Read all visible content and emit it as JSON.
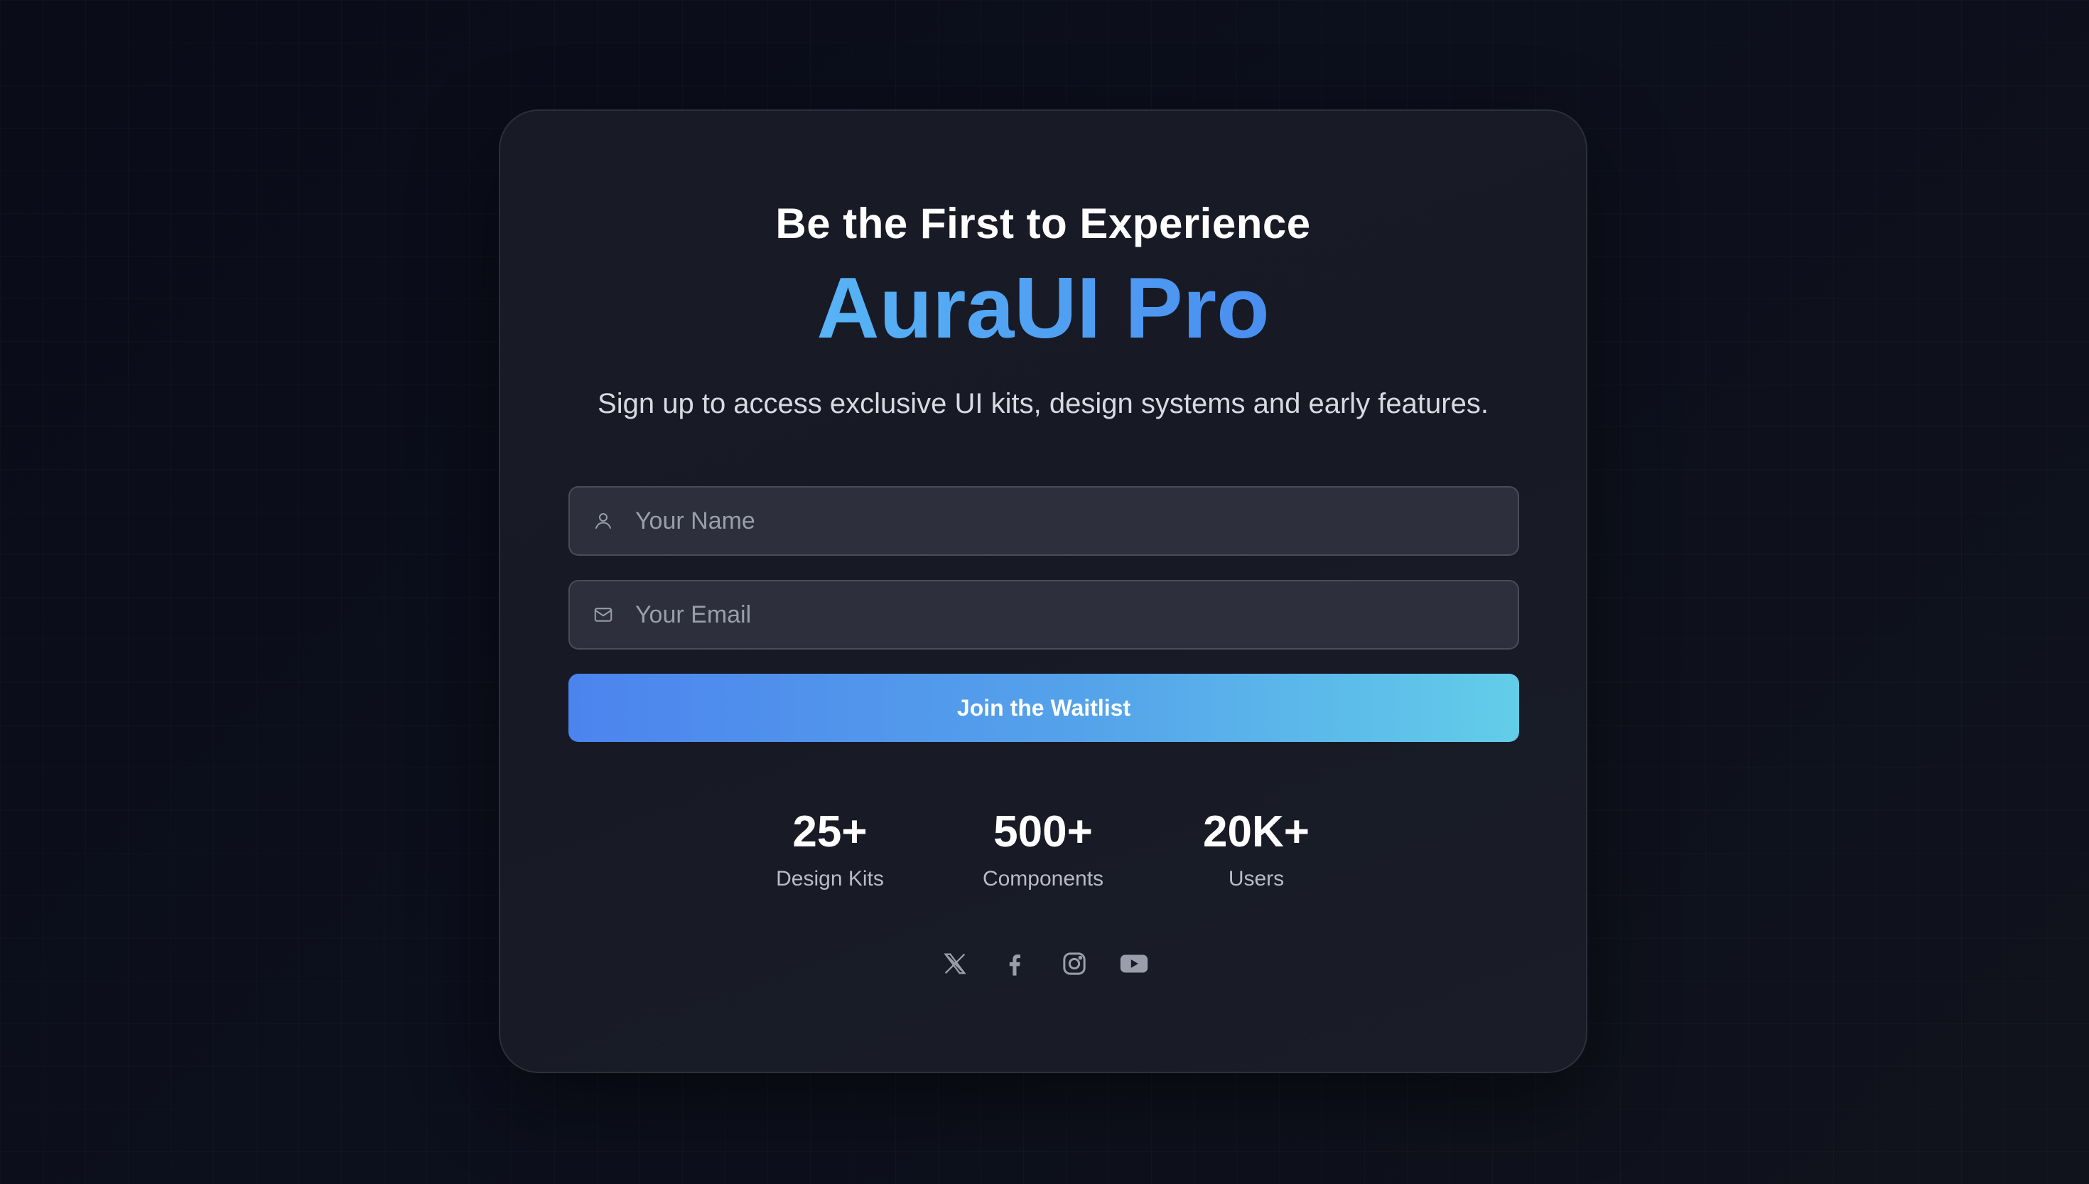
{
  "hero": {
    "eyebrow": "Be the First to Experience",
    "brand": "AuraUI Pro",
    "subtitle": "Sign up to access exclusive UI kits, design systems and early features."
  },
  "form": {
    "name_placeholder": "Your Name",
    "email_placeholder": "Your Email",
    "submit_label": "Join the Waitlist"
  },
  "stats": [
    {
      "value": "25+",
      "label": "Design Kits"
    },
    {
      "value": "500+",
      "label": "Components"
    },
    {
      "value": "20K+",
      "label": "Users"
    }
  ],
  "socials": [
    "x-icon",
    "facebook-icon",
    "instagram-icon",
    "youtube-icon"
  ],
  "colors": {
    "accent_start": "#4c84ee",
    "accent_end": "#62cde9",
    "brand_text": "#4a8ef0"
  }
}
